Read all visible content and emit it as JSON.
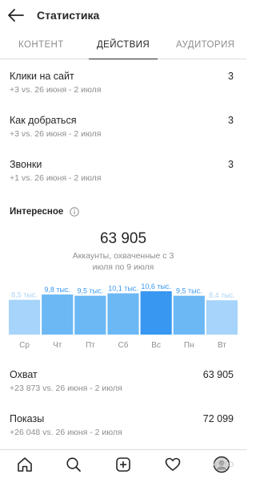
{
  "header": {
    "title": "Статистика",
    "back_icon": "arrow-left-icon"
  },
  "tabs": [
    {
      "label": "КОНТЕНТ",
      "active": false
    },
    {
      "label": "ДЕЙСТВИЯ",
      "active": true
    },
    {
      "label": "АУДИТОРИЯ",
      "active": false
    }
  ],
  "metrics": [
    {
      "label": "Клики на сайт",
      "value": "3",
      "sub": "+3 vs. 26 июня - 2 июля"
    },
    {
      "label": "Как добраться",
      "value": "3",
      "sub": "+3 vs. 26 июня - 2 июля"
    },
    {
      "label": "Звонки",
      "value": "3",
      "sub": "+1 vs. 26 июня - 2 июля"
    }
  ],
  "interesting": {
    "title": "Интересное",
    "info_icon": "info-circle-icon",
    "total": "63 905",
    "caption": "Аккаунты, охваченные с 3 июля по 9 июля"
  },
  "chart_data": {
    "type": "bar",
    "categories": [
      "Ср",
      "Чт",
      "Пт",
      "Сб",
      "Вс",
      "Пн",
      "Вт"
    ],
    "values": [
      8.5,
      9.8,
      9.5,
      10.1,
      10.6,
      9.5,
      8.4
    ],
    "labels": [
      "8,5 тыс.",
      "9,8 тыс.",
      "9,5 тыс.",
      "10,1 тыс.",
      "10,6 тыс.",
      "9,5 тыс.",
      "8,4 тыс."
    ],
    "highlight_index": 4,
    "colors": {
      "light": "#a6d4fa",
      "mid": "#6bb8f5",
      "dark": "#3897f0",
      "label_light": "#a9d3f5",
      "label_dark": "#3897f0"
    }
  },
  "stats": [
    {
      "label": "Охват",
      "value": "63 905",
      "sub": "+23 873 vs. 26 июня - 2 июля"
    },
    {
      "label": "Показы",
      "value": "72 099",
      "sub": "+26 048 vs. 26 июня - 2 июля"
    }
  ],
  "bottom_nav": [
    "home-icon",
    "search-icon",
    "add-post-icon",
    "heart-icon",
    "profile-icon"
  ],
  "watermark": "AVITO"
}
